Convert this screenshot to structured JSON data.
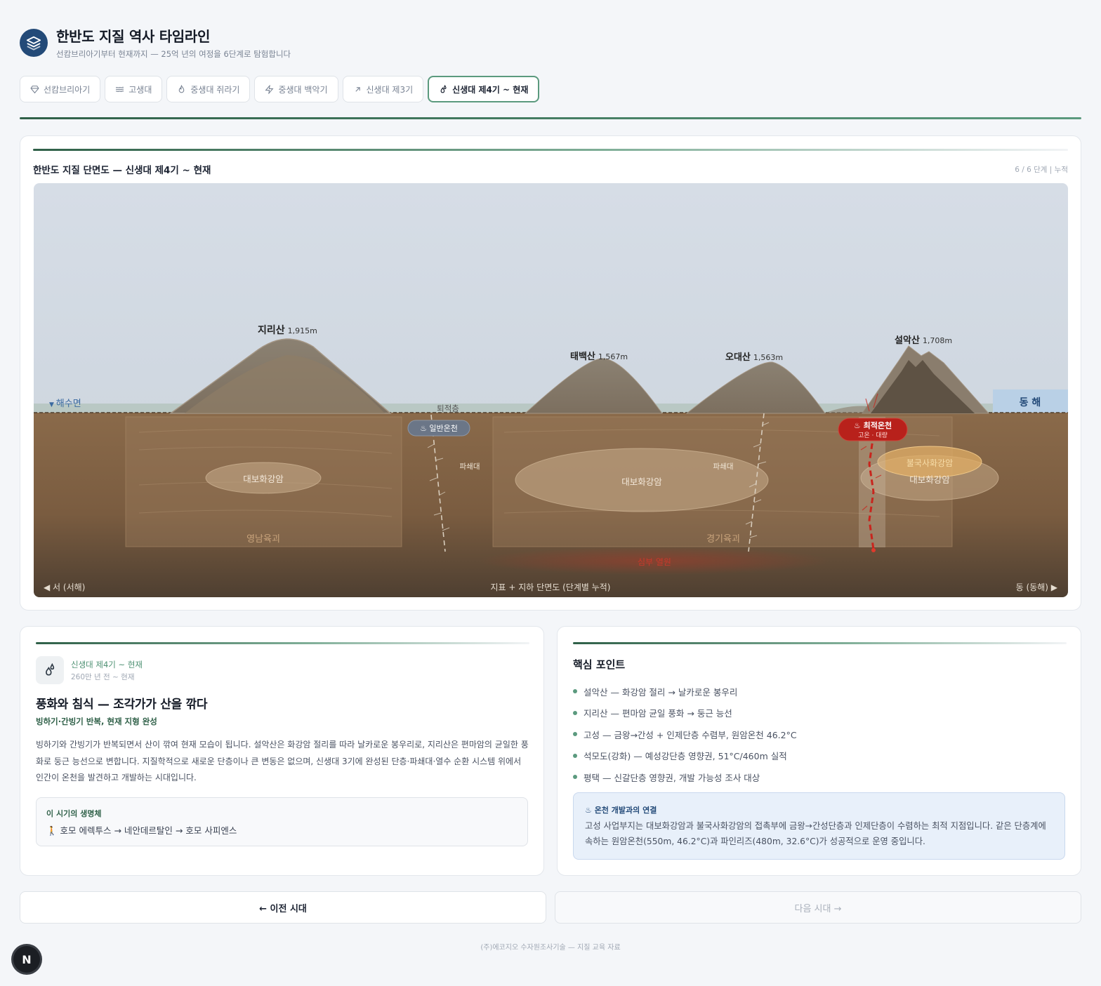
{
  "header": {
    "title": "한반도 지질 역사 타임라인",
    "subtitle": "선캄브리아기부터 현재까지 — 25억 년의 여정을 6단계로 탐험합니다",
    "logo_icon": "layers-icon"
  },
  "tabs": [
    {
      "label": "선캄브리아기",
      "icon": "diamond-icon",
      "active": false
    },
    {
      "label": "고생대",
      "icon": "waves-icon",
      "active": false
    },
    {
      "label": "중생대 쥐라기",
      "icon": "flame-icon",
      "active": false
    },
    {
      "label": "중생대 백악기",
      "icon": "zap-icon",
      "active": false
    },
    {
      "label": "신생대 제3기",
      "icon": "trend-arrow-icon",
      "active": false
    },
    {
      "label": "신생대 제4기 ~ 현재",
      "icon": "droplets-icon",
      "active": true
    }
  ],
  "diagram": {
    "title": "한반도 지질 단면도 — 신생대 제4기 ~ 현재",
    "meta": "6 / 6 단계 | 누적",
    "sea_level_label": "해수면",
    "east_sea_label": "동 해",
    "west_label": "◀ 서 (서해)",
    "east_label": "동 (동해) ▶",
    "center_label": "지표 + 지하 단면도 (단계별 누적)",
    "sediment_label": "퇴적층",
    "mountains": {
      "jiri": {
        "name": "지리산",
        "height": "1,915m"
      },
      "taebaek": {
        "name": "태백산",
        "height": "1,567m"
      },
      "odae": {
        "name": "오대산",
        "height": "1,563m"
      },
      "seorak": {
        "name": "설악산",
        "height": "1,708m"
      }
    },
    "massifs": {
      "yeongnam": "영남육괴",
      "gyeonggi": "경기육괴"
    },
    "granites": {
      "left": "대보화강암",
      "center": "대보화강암",
      "right": "대보화강암",
      "bulguksa": "불국사화강암"
    },
    "fault_zones": {
      "left": "파쇄대",
      "right": "파쇄대"
    },
    "spring_general": "♨ 일반온천",
    "spring_optimal": "♨ 최적온천",
    "spring_optimal_sub": "고온 · 대량",
    "deep_heat": "심부 열원"
  },
  "era": {
    "icon": "droplets-icon",
    "name": "신생대 제4기 ~ 현재",
    "time": "260만 년 전 ~ 현재",
    "headline": "풍화와 침식 — 조각가가 산을 깎다",
    "tagline": "빙하기·간빙기 반복, 현재 지형 완성",
    "description": "빙하기와 간빙기가 반복되면서 산이 깎여 현재 모습이 됩니다. 설악산은 화강암 절리를 따라 날카로운 봉우리로, 지리산은 편마암의 균일한 풍화로 둥근 능선으로 변합니다. 지질학적으로 새로운 단층이나 큰 변동은 없으며, 신생대 3기에 완성된 단층·파쇄대·열수 순환 시스템 위에서 인간이 온천을 발견하고 개발하는 시대입니다.",
    "life_title": "이 시기의 생명체",
    "life_text": "🚶 호모 에렉투스 → 네안데르탈인 → 호모 사피엔스"
  },
  "points": {
    "title": "핵심 포인트",
    "items": [
      "설악산 — 화강암 절리 → 날카로운 봉우리",
      "지리산 — 편마암 균일 풍화 → 둥근 능선",
      "고성 — 금왕→간성 + 인제단층 수렴부, 원암온천 46.2°C",
      "석모도(강화) — 예성강단층 영향권, 51°C/460m 실적",
      "평택 — 신갈단층 영향권, 개발 가능성 조사 대상"
    ],
    "hot_title": "♨ 온천 개발과의 연결",
    "hot_text": "고성 사업부지는 대보화강암과 불국사화강암의 접촉부에 금왕→간성단층과 인제단층이 수렴하는 최적 지점입니다. 같은 단층계에 속하는 원암온천(550m, 46.2°C)과 파인리즈(480m, 32.6°C)가 성공적으로 운영 중입니다."
  },
  "nav": {
    "prev": "← 이전 시대",
    "next": "다음 시대 →"
  },
  "footer": "(주)에코지오 수자원조사기술 — 지질 교육 자료",
  "badge": "N",
  "colors": {
    "accent": "#5b9a7e",
    "brand": "#234a78",
    "hot": "#b8211b"
  }
}
